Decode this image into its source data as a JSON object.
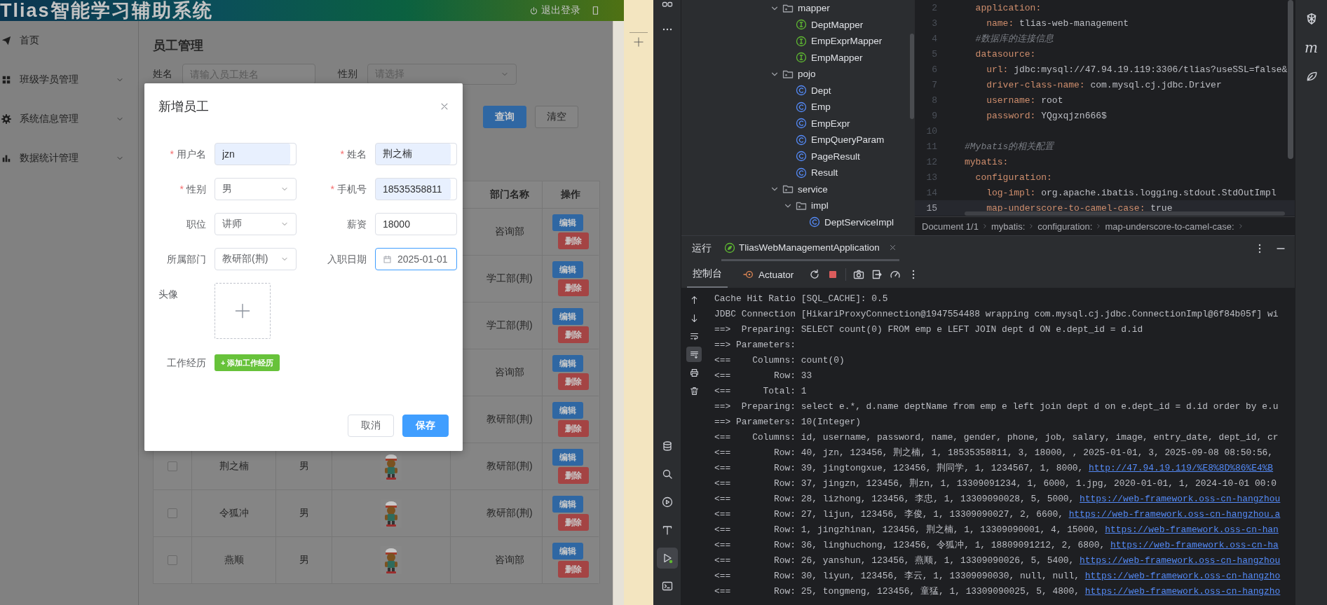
{
  "app": {
    "header": {
      "title": "Tlias智能学习辅助系统",
      "logout": "退出登录"
    },
    "sidebar": [
      {
        "label": "首页",
        "kind": "send",
        "expandable": false
      },
      {
        "label": "班级学员管理",
        "kind": "grid",
        "expandable": true
      },
      {
        "label": "系统信息管理",
        "kind": "gear",
        "expandable": true
      },
      {
        "label": "数据统计管理",
        "kind": "chart",
        "expandable": true
      }
    ],
    "page_title": "员工管理",
    "filters": [
      {
        "label": "姓名",
        "kind": "input",
        "placeholder": "请输入员工姓名"
      },
      {
        "label": "性别",
        "kind": "select",
        "placeholder": "请选择"
      }
    ],
    "buttons": [
      {
        "label": "查询",
        "kind": "primary"
      },
      {
        "label": "清空",
        "kind": "plain"
      }
    ],
    "table": {
      "columns": [
        {
          "label": "部门名称"
        },
        {
          "label": "操作"
        }
      ],
      "rows": [
        {
          "dept": "咨询部",
          "actions": [
            {
              "label": "编辑",
              "kind": "edit"
            },
            {
              "label": "删除",
              "kind": "delete"
            }
          ]
        },
        {
          "dept": "学工部(荆)",
          "actions": [
            {
              "label": "编辑",
              "kind": "edit"
            },
            {
              "label": "删除",
              "kind": "delete"
            }
          ]
        },
        {
          "dept": "学工部(荆)",
          "actions": [
            {
              "label": "编辑",
              "kind": "edit"
            },
            {
              "label": "删除",
              "kind": "delete"
            }
          ]
        },
        {
          "dept": "咨询部",
          "actions": [
            {
              "label": "编辑",
              "kind": "edit"
            },
            {
              "label": "删除",
              "kind": "delete"
            }
          ]
        },
        {
          "dept": "教研部(荆)",
          "actions": [
            {
              "label": "编辑",
              "kind": "edit"
            },
            {
              "label": "删除",
              "kind": "delete"
            }
          ]
        },
        {
          "checked": false,
          "name": "荆之楠",
          "gender": "男",
          "avatar": {
            "kind": "picture"
          },
          "dept": "教研部(荆)",
          "actions": [
            {
              "label": "编辑",
              "kind": "edit"
            },
            {
              "label": "删除",
              "kind": "delete"
            }
          ]
        },
        {
          "checked": false,
          "name": "令狐冲",
          "gender": "男",
          "avatar": {
            "kind": "picture"
          },
          "dept": "教研部(荆)",
          "actions": [
            {
              "label": "编辑",
              "kind": "edit"
            },
            {
              "label": "删除",
              "kind": "delete"
            }
          ]
        },
        {
          "checked": false,
          "name": "燕顺",
          "gender": "男",
          "avatar": {
            "kind": "picture"
          },
          "dept": "咨询部",
          "actions": [
            {
              "label": "编辑",
              "kind": "edit"
            },
            {
              "label": "删除",
              "kind": "delete"
            }
          ]
        }
      ]
    }
  },
  "dialog": {
    "title": "新增员工",
    "fields": [
      {
        "label": "用户名",
        "required_mark": "*",
        "kind": "input",
        "value": "jzn",
        "autofilled": true,
        "focused": false
      },
      {
        "label": "姓名",
        "required_mark": "*",
        "kind": "input",
        "value": "荆之楠",
        "autofilled": true,
        "focused": false
      },
      {
        "label": "性别",
        "required_mark": "*",
        "kind": "select",
        "value": "男",
        "autofilled": false,
        "focused": false
      },
      {
        "label": "手机号",
        "required_mark": "*",
        "kind": "input",
        "value": "18535358811",
        "autofilled": true,
        "focused": false
      },
      {
        "label": "职位",
        "kind": "select",
        "value": "讲师",
        "autofilled": false,
        "focused": false
      },
      {
        "label": "薪资",
        "kind": "input",
        "value": "18000",
        "autofilled": false,
        "focused": false
      },
      {
        "label": "所属部门",
        "kind": "select",
        "value": "教研部(荆)",
        "autofilled": false,
        "focused": false
      },
      {
        "label": "入职日期",
        "kind": "date",
        "value": "2025-01-01",
        "autofilled": false,
        "focused": true
      }
    ],
    "avatar": {
      "label": "头像"
    },
    "experience": {
      "label": "工作经历",
      "button": "+ 添加工作经历"
    },
    "footer": [
      {
        "label": "取消",
        "kind": "plain"
      },
      {
        "label": "保存",
        "kind": "primary"
      }
    ]
  },
  "ide": {
    "tree": [
      {
        "label": "mapper",
        "kind": "package",
        "expanded": true,
        "children": [
          {
            "label": "DeptMapper",
            "kind": "interface"
          },
          {
            "label": "EmpExprMapper",
            "kind": "interface"
          },
          {
            "label": "EmpMapper",
            "kind": "interface"
          }
        ]
      },
      {
        "label": "pojo",
        "kind": "package",
        "expanded": true,
        "children": [
          {
            "label": "Dept",
            "kind": "class"
          },
          {
            "label": "Emp",
            "kind": "class"
          },
          {
            "label": "EmpExpr",
            "kind": "class"
          },
          {
            "label": "EmpQueryParam",
            "kind": "class"
          },
          {
            "label": "PageResult",
            "kind": "class"
          },
          {
            "label": "Result",
            "kind": "class"
          }
        ]
      },
      {
        "label": "service",
        "kind": "package",
        "expanded": true,
        "children": [
          {
            "label": "impl",
            "kind": "package",
            "expanded": true,
            "children": [
              {
                "label": "DeptServiceImpl",
                "kind": "class"
              }
            ]
          }
        ]
      }
    ],
    "editor": {
      "lines": [
        {
          "number": "2",
          "kind": "key",
          "key": "  application:",
          "current": false
        },
        {
          "number": "3",
          "kind": "pair",
          "key": "    name:",
          "value": "tlias-web-management",
          "current": false
        },
        {
          "number": "4",
          "kind": "comment",
          "key": "  #数据库的连接信息",
          "current": false
        },
        {
          "number": "5",
          "kind": "key",
          "key": "  datasource:",
          "current": false
        },
        {
          "number": "6",
          "kind": "pair",
          "key": "    url:",
          "value": "jdbc:mysql://47.94.19.119:3306/tlias?useSSL=false&",
          "current": false
        },
        {
          "number": "7",
          "kind": "pair",
          "key": "    driver-class-name:",
          "value": "com.mysql.cj.jdbc.Driver",
          "current": false
        },
        {
          "number": "8",
          "kind": "pair",
          "key": "    username:",
          "value": "root",
          "current": false
        },
        {
          "number": "9",
          "kind": "pair",
          "key": "    password:",
          "value": "YQgxqjzn666$",
          "current": false
        },
        {
          "number": "10",
          "kind": "blank",
          "current": false
        },
        {
          "number": "11",
          "kind": "comment",
          "key": "#Mybatis的相关配置",
          "current": false
        },
        {
          "number": "12",
          "kind": "key",
          "key": "mybatis:",
          "current": false
        },
        {
          "number": "13",
          "kind": "key",
          "key": "  configuration:",
          "current": false
        },
        {
          "number": "14",
          "kind": "pair",
          "key": "    log-impl:",
          "value": "org.apache.ibatis.logging.stdout.StdOutImpl",
          "current": false
        },
        {
          "number": "15",
          "kind": "pair",
          "key": "    map-underscore-to-camel-case:",
          "value": "true",
          "current": true
        }
      ],
      "breadcrumb": [
        "Document 1/1",
        "mybatis:",
        "configuration:",
        "map-underscore-to-camel-case:"
      ]
    },
    "tool_windows": [
      {
        "kind": "database",
        "selected": false
      },
      {
        "kind": "search",
        "selected": false
      },
      {
        "kind": "services",
        "selected": false
      },
      {
        "kind": "hammer",
        "selected": false
      },
      {
        "kind": "run",
        "selected": true
      },
      {
        "kind": "terminal",
        "selected": false
      }
    ],
    "right_toolbar": {
      "glyph": "m"
    },
    "run": {
      "title": "运行",
      "tabs": [
        {
          "label": "TliasWebManagementApplication",
          "selected": true
        }
      ],
      "subtabs": [
        {
          "label": "控制台",
          "kind": "plain",
          "selected": true
        },
        {
          "label": "Actuator",
          "kind": "actuator",
          "selected": false
        }
      ],
      "console_tools": [
        {
          "kind": "up",
          "selected": false
        },
        {
          "kind": "down",
          "selected": false
        },
        {
          "kind": "wrap",
          "selected": false
        },
        {
          "kind": "scroll-end",
          "selected": true
        },
        {
          "kind": "print",
          "selected": false
        },
        {
          "kind": "trash",
          "selected": false
        }
      ],
      "console": [
        {
          "text": "Cache Hit Ratio [SQL_CACHE]: 0.5"
        },
        {
          "text": "JDBC Connection [HikariProxyConnection@1947554488 wrapping com.mysql.cj.jdbc.ConnectionImpl@6f84b05f] wi"
        },
        {
          "text": "==>  Preparing: SELECT count(0) FROM emp e LEFT JOIN dept d ON e.dept_id = d.id"
        },
        {
          "text": "==> Parameters:"
        },
        {
          "text": "<==    Columns: count(0)"
        },
        {
          "text": "<==        Row: 33"
        },
        {
          "text": "<==      Total: 1"
        },
        {
          "text": "==>  Preparing: select e.*, d.name deptName from emp e left join dept d on e.dept_id = d.id order by e.u"
        },
        {
          "text": "==> Parameters: 10(Integer)"
        },
        {
          "text": "<==    Columns: id, username, password, name, gender, phone, job, salary, image, entry_date, dept_id, cr"
        },
        {
          "text": "<==        Row: 40, jzn, 123456, 荆之楠, 1, 18535358811, 3, 18000, , 2025-01-01, 3, 2025-09-08 08:50:56,"
        },
        {
          "text": "<==        Row: 39, jingtongxue, 123456, 荆同学, 1, 1234567, 1, 8000, ",
          "link": "http://47.94.19.119/%E8%8D%86%E4%B"
        },
        {
          "text": "<==        Row: 37, jingzn, 123456, 荆zn, 1, 13309091234, 1, 6000, 1.jpg, 2020-01-01, 1, 2024-10-01 00:0"
        },
        {
          "text": "<==        Row: 28, lizhong, 123456, 李忠, 1, 13309090028, 5, 5000, ",
          "link": "https://web-framework.oss-cn-hangzhou"
        },
        {
          "text": "<==        Row: 27, lijun, 123456, 李俊, 1, 13309090027, 2, 6600, ",
          "link": "https://web-framework.oss-cn-hangzhou.a"
        },
        {
          "text": "<==        Row: 1, jingzhinan, 123456, 荆之楠, 1, 13309090001, 4, 15000, ",
          "link": "https://web-framework.oss-cn-han"
        },
        {
          "text": "<==        Row: 36, linghuchong, 123456, 令狐冲, 1, 18809091212, 2, 6800, ",
          "link": "https://web-framework.oss-cn-ha"
        },
        {
          "text": "<==        Row: 26, yanshun, 123456, 燕顺, 1, 13309090026, 5, 5400, ",
          "link": "https://web-framework.oss-cn-hangzhou"
        },
        {
          "text": "<==        Row: 30, liyun, 123456, 李云, 1, 13309090030, null, null, ",
          "link": "https://web-framework.oss-cn-hangzho"
        },
        {
          "text": "<==        Row: 25, tongmeng, 123456, 童猛, 1, 13309090025, 5, 4800, ",
          "link": "https://web-framework.oss-cn-hangzho"
        }
      ]
    }
  }
}
